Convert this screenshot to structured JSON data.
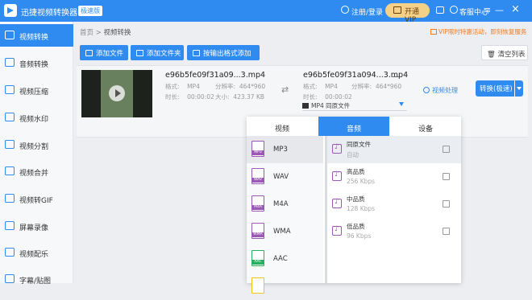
{
  "titlebar": {
    "app_name": "迅捷视频转换器",
    "badge": "极速版",
    "login": "注册/登录",
    "vip": "开通VIP",
    "support": "客服中心",
    "menu": "≡",
    "minimize": "—",
    "close": "×"
  },
  "sidebar": {
    "items": [
      {
        "label": "视频转换"
      },
      {
        "label": "音频转换"
      },
      {
        "label": "视频压缩"
      },
      {
        "label": "视频水印"
      },
      {
        "label": "视频分割"
      },
      {
        "label": "视频合并"
      },
      {
        "label": "视频转GIF"
      },
      {
        "label": "屏幕录像"
      },
      {
        "label": "视频配乐"
      },
      {
        "label": "字幕/贴图"
      }
    ]
  },
  "breadcrumb": {
    "home": "首页",
    "sep": " > ",
    "current": "视频转换"
  },
  "promo": "VIP限时特惠活动，即刻恢复服务",
  "toolbar": {
    "add_file": "添加文件",
    "add_folder": "添加文件夹",
    "add_by_format": "按输出格式添加",
    "clear": "清空列表"
  },
  "file": {
    "source_name": "e96b5fe09f31a09...3.mp4",
    "output_name": "e96b5fe09f31a094...3.mp4",
    "src_format_label": "格式:",
    "src_format": "MP4",
    "src_res_label": "分辨率:",
    "src_res": "464*960",
    "src_duration_label": "时长:",
    "src_duration": "00:00:02",
    "src_size_label": "大小:",
    "src_size": "423.37 KB",
    "out_format_label": "格式:",
    "out_format": "MP4",
    "out_res_label": "分辨率:",
    "out_res": "464*960",
    "out_duration_label": "时长:",
    "out_duration": "00:00:02",
    "output_select": "MP4  同原文件",
    "video_process": "视频处理",
    "convert": "转换(极速)"
  },
  "panel": {
    "tabs": [
      "视频",
      "音频",
      "设备"
    ],
    "formats": [
      "MP3",
      "WAV",
      "M4A",
      "WMA",
      "AAC"
    ],
    "qualities": [
      {
        "name": "同原文件",
        "rate": "自动"
      },
      {
        "name": "高品质",
        "rate": "256 Kbps"
      },
      {
        "name": "中品质",
        "rate": "128 Kbps"
      },
      {
        "name": "低品质",
        "rate": "96 Kbps"
      }
    ]
  }
}
